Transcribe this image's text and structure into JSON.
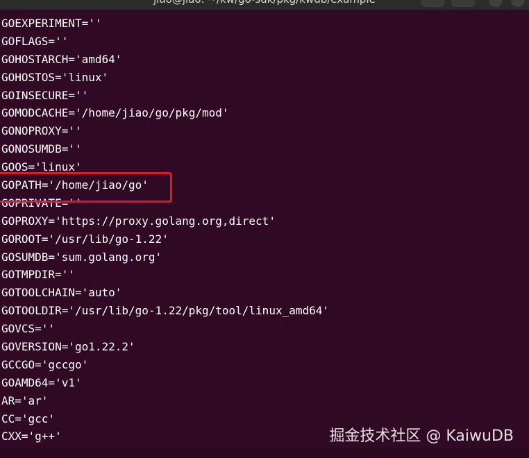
{
  "window": {
    "title": "jiao@jiao: ~/kw/go-sdk/pkg/kwdb/example"
  },
  "terminal": {
    "lines": [
      "GOEXPERIMENT=''",
      "GOFLAGS=''",
      "GOHOSTARCH='amd64'",
      "GOHOSTOS='linux'",
      "GOINSECURE=''",
      "GOMODCACHE='/home/jiao/go/pkg/mod'",
      "GONOPROXY=''",
      "GONOSUMDB=''",
      "GOOS='linux'",
      "GOPATH='/home/jiao/go'",
      "GOPRIVATE=''",
      "GOPROXY='https://proxy.golang.org,direct'",
      "GOROOT='/usr/lib/go-1.22'",
      "GOSUMDB='sum.golang.org'",
      "GOTMPDIR=''",
      "GOTOOLCHAIN='auto'",
      "GOTOOLDIR='/usr/lib/go-1.22/pkg/tool/linux_amd64'",
      "GOVCS=''",
      "GOVERSION='go1.22.2'",
      "GCCGO='gccgo'",
      "GOAMD64='v1'",
      "AR='ar'",
      "CC='gcc'",
      "CXX='g++'"
    ]
  },
  "annotation": {
    "color": "#e0182a"
  },
  "watermark": {
    "text": "掘金技术社区 @ KaiwuDB"
  },
  "colors": {
    "background": "#300a24",
    "foreground": "#ffffff"
  }
}
